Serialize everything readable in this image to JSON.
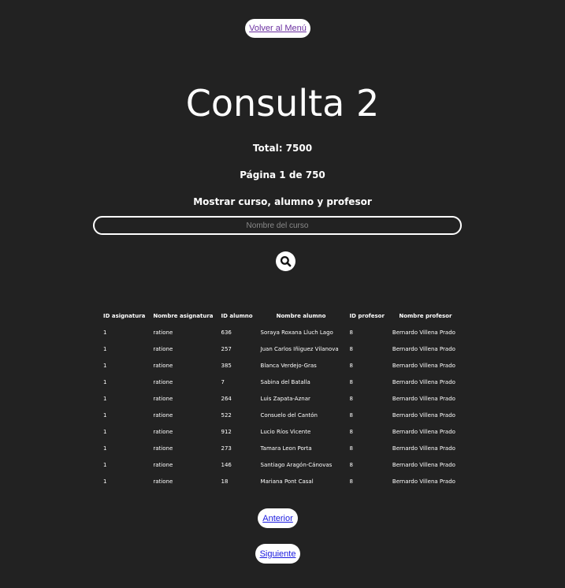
{
  "nav": {
    "back_label": "Volver al Menú"
  },
  "header": {
    "title": "Consulta 2",
    "total": "Total: 7500",
    "pagina": "Página 1 de 750",
    "description": "Mostrar curso, alumno y profesor"
  },
  "search": {
    "placeholder": "Nombre del curso",
    "value": "",
    "button_icon": "search-icon"
  },
  "table": {
    "headers": [
      "ID asignatura",
      "Nombre asignatura",
      "ID alumno",
      "Nombre alumno",
      "ID profesor",
      "Nombre profesor"
    ],
    "rows": [
      [
        "1",
        "ratione",
        "636",
        "Soraya Roxana Lluch Lago",
        "8",
        "Bernardo Villena Prado"
      ],
      [
        "1",
        "ratione",
        "257",
        "Juan Carlos Iñiguez Vilanova",
        "8",
        "Bernardo Villena Prado"
      ],
      [
        "1",
        "ratione",
        "385",
        "Blanca Verdejo-Gras",
        "8",
        "Bernardo Villena Prado"
      ],
      [
        "1",
        "ratione",
        "7",
        "Sabina del Batalla",
        "8",
        "Bernardo Villena Prado"
      ],
      [
        "1",
        "ratione",
        "264",
        "Luis Zapata-Aznar",
        "8",
        "Bernardo Villena Prado"
      ],
      [
        "1",
        "ratione",
        "522",
        "Consuelo del Cantón",
        "8",
        "Bernardo Villena Prado"
      ],
      [
        "1",
        "ratione",
        "912",
        "Lucio Ríos Vicente",
        "8",
        "Bernardo Villena Prado"
      ],
      [
        "1",
        "ratione",
        "273",
        "Tamara Leon Porta",
        "8",
        "Bernardo Villena Prado"
      ],
      [
        "1",
        "ratione",
        "146",
        "Santiago Aragón-Cánovas",
        "8",
        "Bernardo Villena Prado"
      ],
      [
        "1",
        "ratione",
        "18",
        "Mariana Pont Casal",
        "8",
        "Bernardo Villena Prado"
      ]
    ]
  },
  "pagination": {
    "prev_label": "Anterior",
    "next_label": "Siguiente"
  }
}
